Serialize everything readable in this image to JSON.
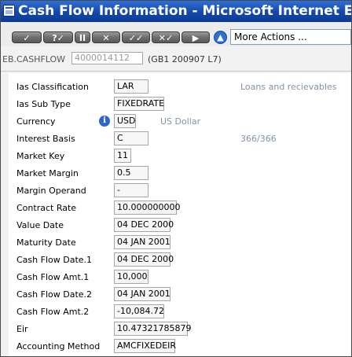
{
  "window": {
    "title": "Cash Flow Information - Microsoft Internet Explorer"
  },
  "toolbar": {
    "buttons": [
      "✓",
      "?✓",
      "II",
      "✕",
      "✓✓",
      "✕✓",
      "▶"
    ],
    "more_actions": "More Actions ..."
  },
  "record": {
    "application": "EB.CASHFLOW",
    "id": "4000014112",
    "subtitle": "(GB1 200907 L7)"
  },
  "fields": [
    {
      "label": "Ias Classification",
      "value": "LAR",
      "description": "Loans and recievables"
    },
    {
      "label": "Ias Sub Type",
      "value": "FIXEDRATE"
    },
    {
      "label": "Currency",
      "value": "USD",
      "description": "US Dollar"
    },
    {
      "label": "Interest Basis",
      "value": "C",
      "description": "366/366"
    },
    {
      "label": "Market Key",
      "value": "11"
    },
    {
      "label": "Market Margin",
      "value": "0.5"
    },
    {
      "label": "Margin Operand",
      "value": "-"
    },
    {
      "label": "Contract Rate",
      "value": "10.000000000"
    },
    {
      "label": "Value Date",
      "value": "04 DEC 2000"
    },
    {
      "label": "Maturity Date",
      "value": "04 JAN 2001"
    },
    {
      "label": "Cash Flow Date.1",
      "value": "04 DEC 2000"
    },
    {
      "label": "Cash Flow Amt.1",
      "value": "10,000"
    },
    {
      "label": "Cash Flow Date.2",
      "value": "04 JAN 2001"
    },
    {
      "label": "Cash Flow Amt.2",
      "value": "-10,084.72"
    },
    {
      "label": "Eir",
      "value": "10.47321785879"
    },
    {
      "label": "Accounting Method",
      "value": "AMCFIXEDEIR"
    }
  ]
}
